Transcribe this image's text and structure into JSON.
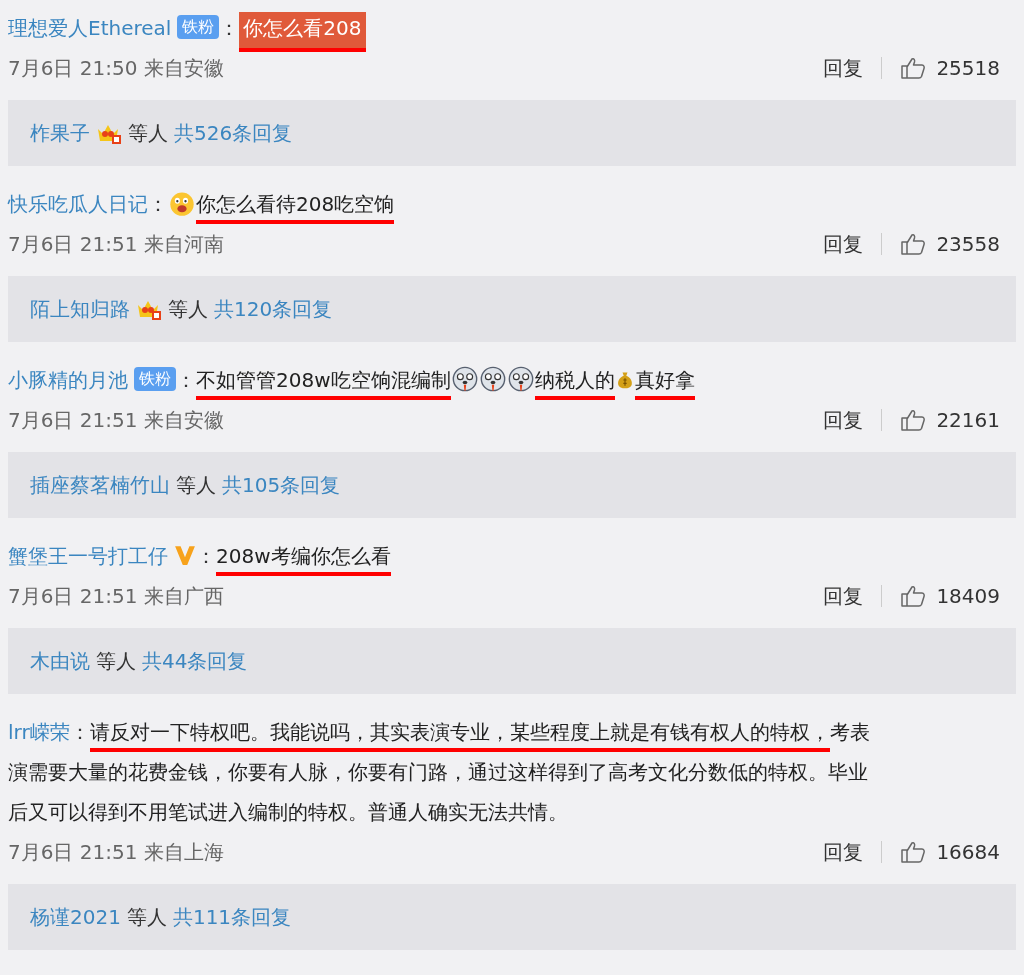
{
  "comments": [
    {
      "user": "理想爱人Ethereal",
      "badge": {
        "kind": "fan",
        "text": "铁粉"
      },
      "colon": "：",
      "parts": [
        {
          "kind": "text",
          "text": "你怎么看208",
          "highlighted": true,
          "underlined": true
        }
      ],
      "time": "7月6日 21:50 来自安徽",
      "reply": "回复",
      "likes": "25518",
      "thread": {
        "user": "柞果子",
        "crown": true,
        "others": "等人",
        "count": "共526条回复"
      }
    },
    {
      "user": "快乐吃瓜人日记",
      "colon": "：",
      "parts": [
        {
          "kind": "grin"
        },
        {
          "kind": "text",
          "text": "你怎么看待208吃空饷",
          "highlighted": false,
          "underlined": true
        }
      ],
      "time": "7月6日 21:51 来自河南",
      "reply": "回复",
      "likes": "23558",
      "thread": {
        "user": "陌上知归路",
        "crown": true,
        "others": "等人",
        "count": "共120条回复"
      }
    },
    {
      "user": "小豚精的月池",
      "badge": {
        "kind": "fan",
        "text": "铁粉"
      },
      "colon": "：",
      "parts": [
        {
          "kind": "text",
          "text": "不如管管208w吃空饷混编制",
          "highlighted": false,
          "underlined": true
        },
        {
          "kind": "dog"
        },
        {
          "kind": "dog"
        },
        {
          "kind": "dog"
        },
        {
          "kind": "text",
          "text": "纳税人的",
          "highlighted": false,
          "underlined": true
        },
        {
          "kind": "moneybag"
        },
        {
          "kind": "text",
          "text": "真好拿",
          "highlighted": false,
          "underlined": true
        }
      ],
      "time": "7月6日 21:51 来自安徽",
      "reply": "回复",
      "likes": "22161",
      "thread": {
        "user": "插座蔡茗楠竹山",
        "crown": false,
        "others": "等人",
        "count": "共105条回复"
      }
    },
    {
      "user": "蟹堡王一号打工仔",
      "badge": {
        "kind": "v"
      },
      "colon": "：",
      "parts": [
        {
          "kind": "text",
          "text": "208w考编你怎么看",
          "highlighted": false,
          "underlined": true
        }
      ],
      "time": "7月6日 21:51 来自广西",
      "reply": "回复",
      "likes": "18409",
      "thread": {
        "user": "木由说",
        "crown": false,
        "others": "等人",
        "count": "共44条回复"
      }
    },
    {
      "user": "lrr嵘荣",
      "colon": "：",
      "parts": [
        {
          "kind": "text",
          "text": "请反对一下特权吧。我能说吗，其实表演专业，某些程度上就是有钱有权人的特权，",
          "highlighted": false,
          "underlined": true
        },
        {
          "kind": "text",
          "text": "考表",
          "highlighted": false,
          "underlined": false
        },
        {
          "kind": "break"
        },
        {
          "kind": "text",
          "text": "演需要大量的花费金钱，你要有人脉，你要有门路，通过这样得到了高考文化分数低的特权。毕业",
          "highlighted": false,
          "underlined": false
        },
        {
          "kind": "break"
        },
        {
          "kind": "text",
          "text": "后又可以得到不用笔试进入编制的特权。普通人确实无法共情。",
          "highlighted": false,
          "underlined": false
        }
      ],
      "time": "7月6日 21:51 来自上海",
      "reply": "回复",
      "likes": "16684",
      "thread": {
        "user": "杨谨2021",
        "crown": false,
        "others": "等人",
        "count": "共111条回复"
      }
    }
  ]
}
